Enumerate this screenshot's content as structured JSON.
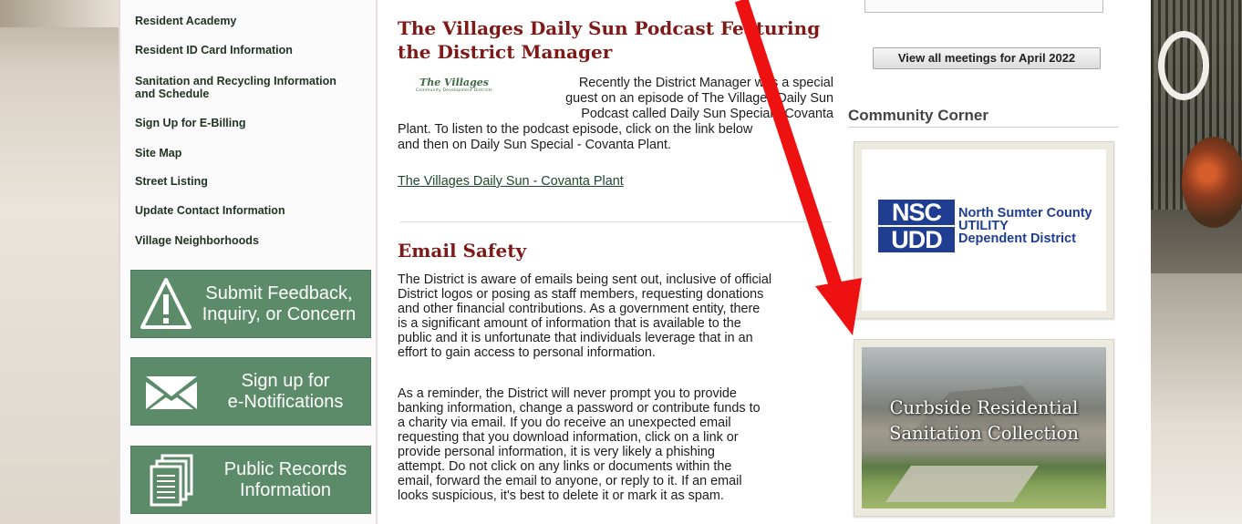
{
  "nav": {
    "items": [
      {
        "label": "Resident Academy"
      },
      {
        "label": "Resident ID Card Information"
      },
      {
        "label": "Sanitation and Recycling Information and Schedule"
      },
      {
        "label": "Sign Up for E-Billing"
      },
      {
        "label": "Site Map"
      },
      {
        "label": "Street Listing"
      },
      {
        "label": "Update Contact Information"
      },
      {
        "label": "Village Neighborhoods"
      }
    ]
  },
  "cta": {
    "feedback": {
      "line1": "Submit Feedback,",
      "line2": "Inquiry, or Concern",
      "icon": "warning-icon"
    },
    "notifications": {
      "line1": "Sign up for",
      "line2": "e-Notifications",
      "icon": "envelope-icon"
    },
    "records": {
      "line1": "Public Records",
      "line2": "Information",
      "icon": "documents-icon"
    }
  },
  "podcast": {
    "title_line1": "The Villages Daily Sun Podcast Featuring",
    "title_line2": "the District Manager",
    "logo_text": "The Villages",
    "logo_subtext": "Community Development Districts",
    "lines": [
      "Recently the District Manager was a special",
      "guest on an episode of The Villages Daily Sun",
      "Podcast called Daily Sun Special - Covanta",
      "Plant.  To listen to the podcast episode, click on the link below",
      "and then on Daily Sun Special - Covanta Plant."
    ],
    "link": "The Villages Daily Sun - Covanta Plant"
  },
  "email_safety": {
    "title": "Email Safety",
    "para1": [
      "The District is aware of emails being sent out, inclusive of official",
      "District logos or posing as staff members, requesting donations",
      "and other financial contributions. As a government entity, there",
      "is a significant amount of information that is available to the",
      "public and it is unfortunate that individuals leverage that in an",
      "effort to gain access to personal information."
    ],
    "para2": [
      "As a reminder, the District will never prompt you to provide",
      "banking information, change a password or contribute funds to",
      "a charity via email. If you do receive an unexpected email",
      "requesting that you download information, click on a link or",
      "provide personal information, it is very likely a phishing",
      "attempt.  Do not click on any links or documents within the",
      "email, forward the email to anyone, or reply to it. If an email",
      "looks suspicious, it's best to delete it or mark it as spam."
    ]
  },
  "sidebar_right": {
    "meetings_button": "View all meetings for April 2022",
    "community_corner_title": "Community Corner",
    "nsc_logo": {
      "word1": "NSC",
      "word2": "UDD",
      "line1": "North Sumter County",
      "line2": "UTILITY",
      "line3": "Dependent District"
    },
    "curbside": {
      "line1": "Curbside Residential",
      "line2": "Sanitation Collection"
    }
  },
  "colors": {
    "heading": "#7d1a17",
    "cta_green": "#5c8b6a",
    "nsc_blue": "#1f3d91",
    "arrow_red": "#ee1111"
  }
}
